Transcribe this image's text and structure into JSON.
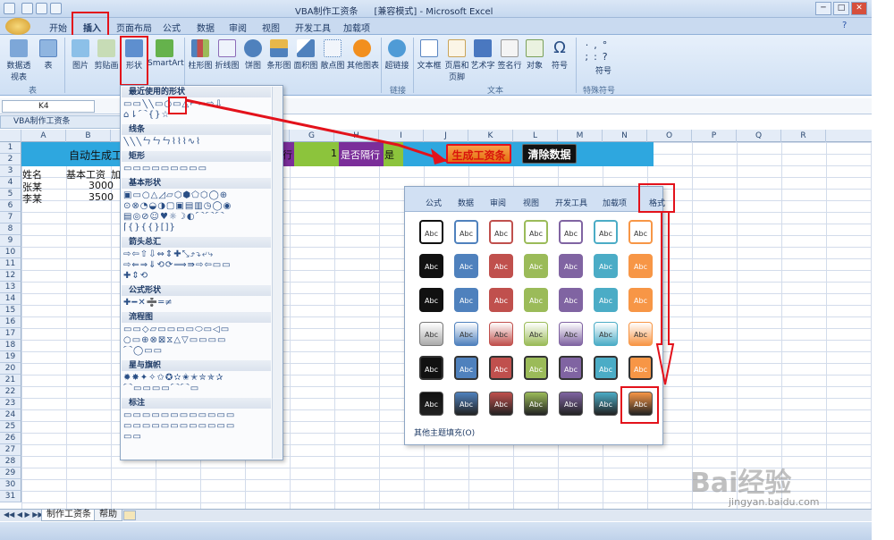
{
  "window": {
    "title": "VBA制作工资条         [兼容模式] - Microsoft Excel",
    "controls": [
      "─",
      "□",
      "✕"
    ]
  },
  "ribbon_tabs": [
    "开始",
    "插入",
    "页面布局",
    "公式",
    "数据",
    "审阅",
    "视图",
    "开发工具",
    "加载项"
  ],
  "active_tab": "插入",
  "ribbon": {
    "table_group": {
      "label": "表",
      "buttons": [
        "数据透视表",
        "表"
      ]
    },
    "illustration": {
      "buttons": [
        "图片",
        "剪贴画",
        "形状",
        "SmartArt"
      ]
    },
    "charts": {
      "buttons": [
        "柱形图",
        "折线图",
        "饼图",
        "条形图",
        "面积图",
        "散点图",
        "其他图表"
      ]
    },
    "links": {
      "label": "链接",
      "buttons": [
        "超链接"
      ]
    },
    "text": {
      "label": "文本",
      "buttons": [
        "文本框",
        "页眉和页脚",
        "艺术字",
        "签名行",
        "对象",
        "符号"
      ]
    },
    "special": {
      "label": "特殊符号",
      "buttons": [
        "符号"
      ]
    }
  },
  "formula_bar": {
    "name_box": "K4"
  },
  "document_tab": "VBA制作工资条",
  "columns": [
    "A",
    "B",
    "C",
    "D",
    "E",
    "F",
    "G",
    "H",
    "I",
    "J",
    "K",
    "L",
    "M",
    "N",
    "O",
    "P",
    "Q",
    "R"
  ],
  "rows": [
    "1",
    "2",
    "3",
    "4",
    "5",
    "6",
    "7",
    "8",
    "9",
    "10",
    "11",
    "12",
    "13",
    "14",
    "15",
    "16",
    "17",
    "18",
    "19",
    "20",
    "21",
    "22",
    "23",
    "24",
    "25",
    "26",
    "27",
    "28",
    "29",
    "30",
    "31"
  ],
  "cells": {
    "b1": "自动生成工",
    "f1": "行",
    "g1": "1",
    "h1": "是否隔行",
    "i1": "是",
    "a2": "姓名",
    "b2": "基本工资",
    "c2": "加",
    "a3": "张某",
    "b3": "3000",
    "a4": "李某",
    "b4": "3500"
  },
  "buttons": {
    "generate": "生成工资条",
    "clear": "清除数据"
  },
  "shapes_menu": {
    "sections": [
      "最近使用的形状",
      "线条",
      "矩形",
      "基本形状",
      "箭头总汇",
      "公式形状",
      "流程图",
      "星与旗帜",
      "标注"
    ],
    "rows": {
      "recent": [
        "▭▭╲╲▭○▭△⌐⌐⇨⇩",
        "⌂⇂⌒{}☆"
      ],
      "lines": [
        "╲╲╲ㄣㄣㄣ⌇⌇⌇∿⌇"
      ],
      "rect": [
        "▭▭▭▭▭▭▭▭▭"
      ],
      "basic": [
        "▣▭○△◿▱⬡⬢⬠⬡◯⊕",
        "⊙⊗◔◒◑▢▣▤▥◷◯◉",
        "▤◎⊘☺♥☼☽◐⌒⌒⌒",
        "⌈{}{{}[]}"
      ],
      "arrows": [
        "⇨⇦⇧⇩⇔⇕✚⤡⤴⤵⤶⤷",
        "⇨⇐⇒⇓⟲⟳⟹⇛⇨⇦▭▭",
        "✚⇕⟲"
      ],
      "equation": [
        "✚━✕➗═≠"
      ],
      "flow": [
        "▭▭◇▱▭▭▭▭⬭▭◁▭",
        "○▭⊕⊗⊠⧖△▽▭▭▭▭",
        "⌒◯▭▭"
      ],
      "stars": [
        "✹✸✦✧✩✪✫✬✭✮✯✰",
        "⌒▭▭▭▭⌒⌒▭"
      ],
      "callouts": [
        "▭▭▭▭▭▭▭▭▭▭▭▭",
        "▭▭▭▭▭▭▭▭▭▭▭▭",
        "▭▭"
      ]
    }
  },
  "styles_gallery": {
    "tabs": [
      "公式",
      "数据",
      "审阅",
      "视图",
      "开发工具",
      "加载项",
      "格式"
    ],
    "swatch_label": "Abc",
    "footer": "其他主题填充(O)",
    "colors": [
      "#ffffff",
      "#4f81bd",
      "#c0504d",
      "#9bbb59",
      "#8064a2",
      "#4bacc6",
      "#f79646"
    ],
    "row_styles": [
      "outline",
      "solid",
      "solid",
      "gradient",
      "dark",
      "bright"
    ]
  },
  "sheet_tabs": [
    "制作工资条",
    "帮助"
  ],
  "watermark": {
    "brand": "Bai经验",
    "url": "jingyan.baidu.com"
  },
  "accent": {
    "red_highlight": "#e3121b",
    "blue_header": "#2ea7df",
    "green": "#8cc43c",
    "purple": "#7b2e9a",
    "orange": "#f3811d"
  }
}
